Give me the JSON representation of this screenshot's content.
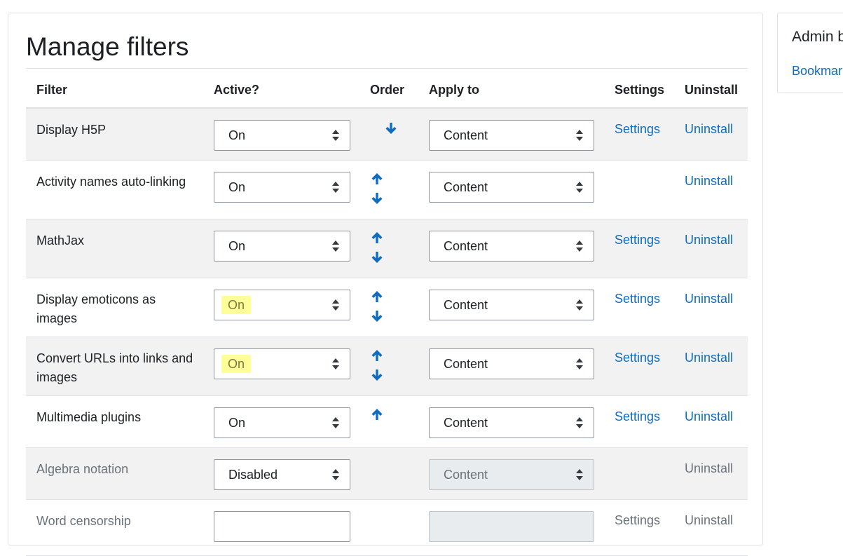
{
  "page_title": "Manage filters",
  "table": {
    "headers": {
      "filter": "Filter",
      "active": "Active?",
      "order": "Order",
      "apply_to": "Apply to",
      "settings": "Settings",
      "uninstall": "Uninstall"
    },
    "rows": [
      {
        "name": "Display H5P",
        "active": "On",
        "apply_to": "Content",
        "settings": "Settings",
        "uninstall": "Uninstall",
        "order_up": false,
        "order_down": true,
        "highlighted": false,
        "disabled": false
      },
      {
        "name": "Activity names auto-linking",
        "active": "On",
        "apply_to": "Content",
        "settings": "",
        "uninstall": "Uninstall",
        "order_up": true,
        "order_down": true,
        "highlighted": false,
        "disabled": false
      },
      {
        "name": "MathJax",
        "active": "On",
        "apply_to": "Content",
        "settings": "Settings",
        "uninstall": "Uninstall",
        "order_up": true,
        "order_down": true,
        "highlighted": false,
        "disabled": false
      },
      {
        "name": "Display emoticons as images",
        "active": "On",
        "apply_to": "Content",
        "settings": "Settings",
        "uninstall": "Uninstall",
        "order_up": true,
        "order_down": true,
        "highlighted": true,
        "disabled": false
      },
      {
        "name": "Convert URLs into links and images",
        "active": "On",
        "apply_to": "Content",
        "settings": "Settings",
        "uninstall": "Uninstall",
        "order_up": true,
        "order_down": true,
        "highlighted": true,
        "disabled": false
      },
      {
        "name": "Multimedia plugins",
        "active": "On",
        "apply_to": "Content",
        "settings": "Settings",
        "uninstall": "Uninstall",
        "order_up": true,
        "order_down": false,
        "highlighted": false,
        "disabled": false
      },
      {
        "name": "Algebra notation",
        "active": "Disabled",
        "apply_to": "Content",
        "settings": "",
        "uninstall": "Uninstall",
        "order_up": false,
        "order_down": false,
        "highlighted": false,
        "disabled": true
      },
      {
        "name": "Word censorship",
        "active": "",
        "apply_to": "",
        "settings": "Settings",
        "uninstall": "Uninstall",
        "order_up": false,
        "order_down": false,
        "highlighted": false,
        "disabled": true
      }
    ]
  },
  "sidebar": {
    "title": "Admin bookmarks",
    "link": "Bookmark this page"
  },
  "colors": {
    "link": "#0f6cbf",
    "highlight": "#ffff99",
    "stripe": "#f2f2f2",
    "muted": "#6a737b"
  },
  "icons": {
    "order_up": "arrow-up-icon",
    "order_down": "arrow-down-icon",
    "select_caret": "sort-caret-icon"
  }
}
